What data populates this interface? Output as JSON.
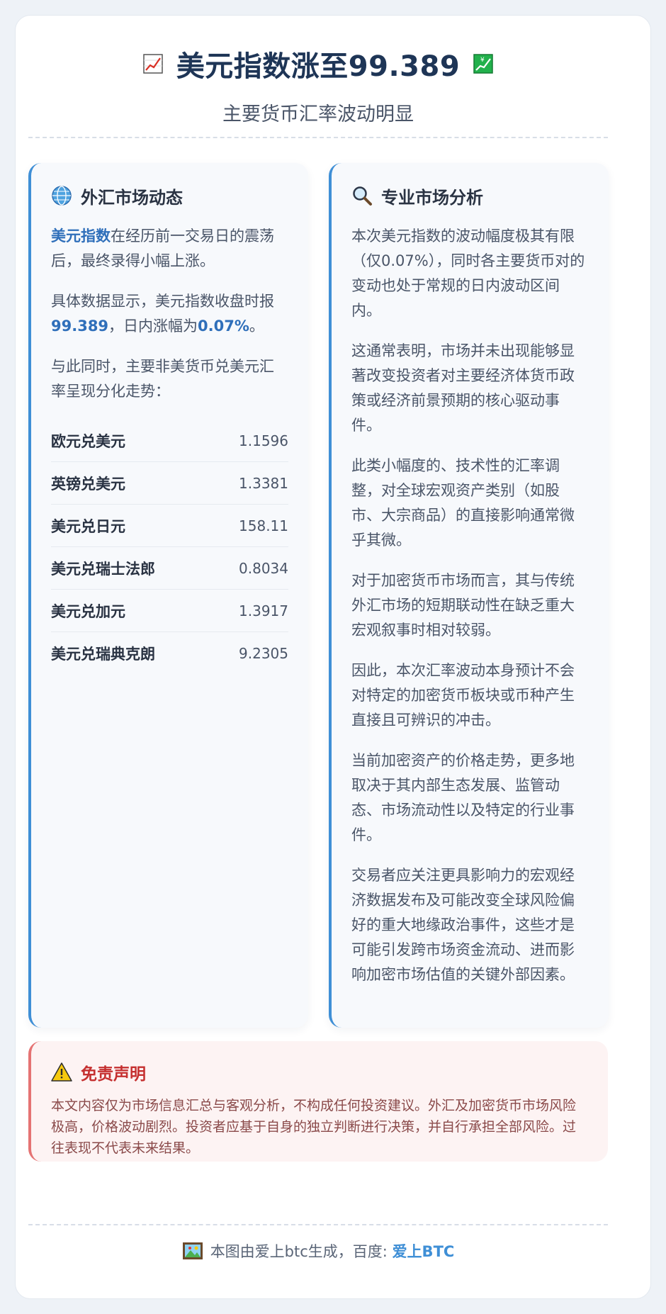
{
  "header": {
    "title": "美元指数涨至99.389",
    "subtitle": "主要货币汇率波动明显",
    "icon_left": "chart-increasing-icon",
    "icon_right": "yen-chart-icon"
  },
  "left_panel": {
    "title": "外汇市场动态",
    "icon": "globe-icon",
    "p1_highlight": "美元指数",
    "p1_rest": "在经历前一交易日的震荡后，最终录得小幅上涨。",
    "p2_prefix": "具体数据显示，美元指数收盘时报",
    "p2_value": "99.389",
    "p2_mid": "，日内涨幅为",
    "p2_change": "0.07%",
    "p2_suffix": "。",
    "p3": "与此同时，主要非美货币兑美元汇率呈现分化走势：",
    "rates": [
      {
        "name": "欧元兑美元",
        "value": "1.1596"
      },
      {
        "name": "英镑兑美元",
        "value": "1.3381"
      },
      {
        "name": "美元兑日元",
        "value": "158.11"
      },
      {
        "name": "美元兑瑞士法郎",
        "value": "0.8034"
      },
      {
        "name": "美元兑加元",
        "value": "1.3917"
      },
      {
        "name": "美元兑瑞典克朗",
        "value": "9.2305"
      }
    ]
  },
  "right_panel": {
    "title": "专业市场分析",
    "icon": "magnifier-icon",
    "paragraphs": [
      "本次美元指数的波动幅度极其有限（仅0.07%），同时各主要货币对的变动也处于常规的日内波动区间内。",
      "这通常表明，市场并未出现能够显著改变投资者对主要经济体货币政策或经济前景预期的核心驱动事件。",
      "此类小幅度的、技术性的汇率调整，对全球宏观资产类别（如股市、大宗商品）的直接影响通常微乎其微。",
      "对于加密货币市场而言，其与传统外汇市场的短期联动性在缺乏重大宏观叙事时相对较弱。",
      "因此，本次汇率波动本身预计不会对特定的加密货币板块或币种产生直接且可辨识的冲击。",
      "当前加密资产的价格走势，更多地取决于其内部生态发展、监管动态、市场流动性以及特定的行业事件。",
      "交易者应关注更具影响力的宏观经济数据发布及可能改变全球风险偏好的重大地缘政治事件，这些才是可能引发跨市场资金流动、进而影响加密市场估值的关键外部因素。"
    ]
  },
  "disclaimer": {
    "title": "免责声明",
    "icon": "warning-icon",
    "text": "本文内容仅为市场信息汇总与客观分析，不构成任何投资建议。外汇及加密货币市场风险极高，价格波动剧烈。投资者应基于自身的独立判断进行决策，并自行承担全部风险。过往表现不代表未来结果。"
  },
  "footer": {
    "icon": "picture-icon",
    "text": "本图由爱上btc生成，百度: ",
    "link": "爱上BTC"
  },
  "colors": {
    "accent": "#3f8fd6",
    "title": "#1e3556",
    "warning": "#c53030"
  }
}
